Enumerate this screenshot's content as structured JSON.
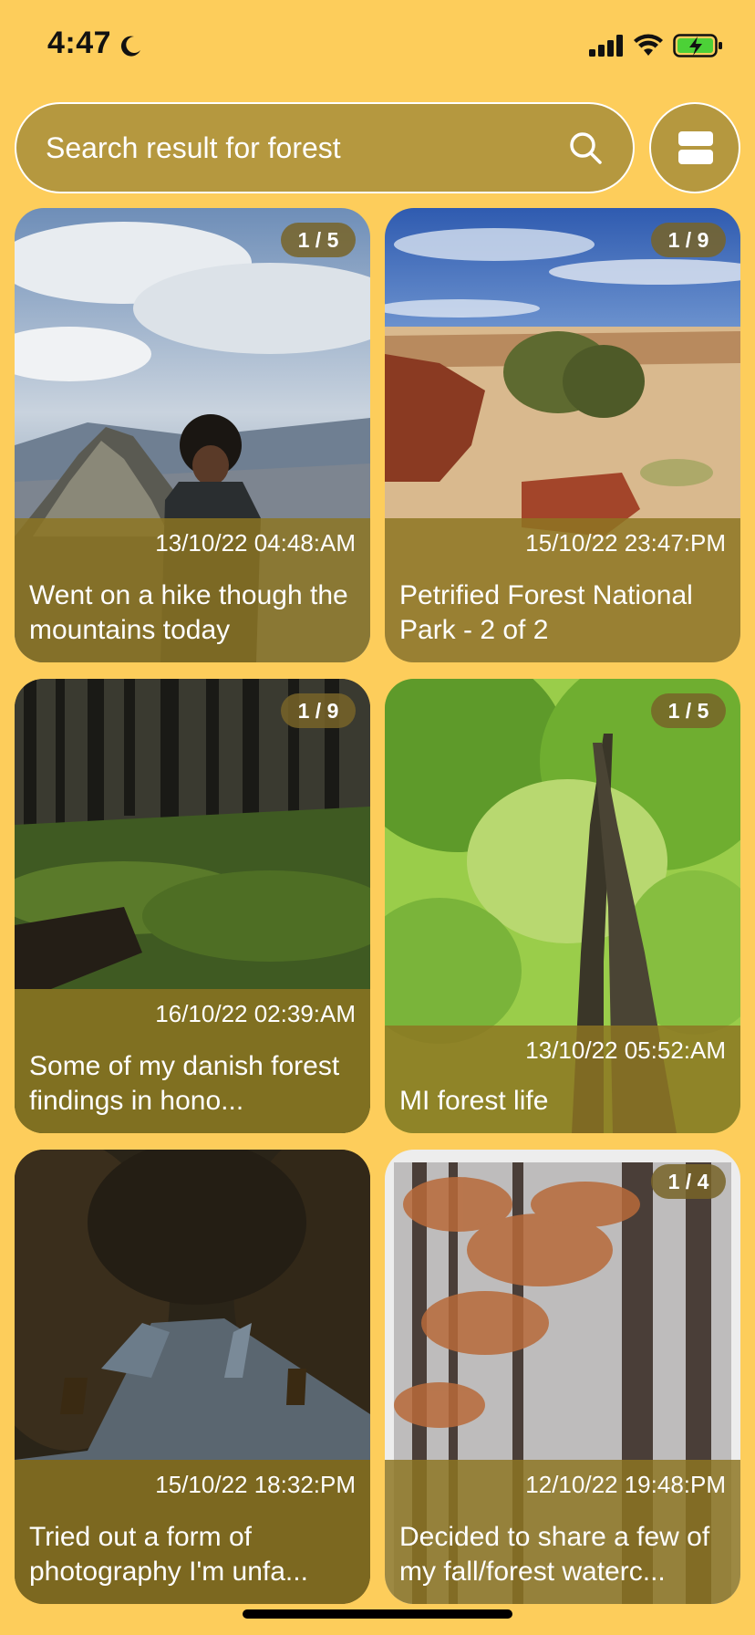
{
  "status": {
    "time": "4:47",
    "icons": [
      "moon-icon",
      "cellular-signal-icon",
      "wifi-icon",
      "battery-charging-icon"
    ]
  },
  "search": {
    "placeholder": "Search result for forest",
    "icon": "search-icon"
  },
  "layout_toggle": {
    "icon": "list-view-icon"
  },
  "colors": {
    "background": "#FDCD5B",
    "search_fill": "#B5983F",
    "overlay": "#8C731E",
    "text": "#FFFFFF"
  },
  "posts": [
    {
      "badge": "1 / 5",
      "date": "13/10/22 04:48:AM",
      "caption": "Went on a hike though the mountains today"
    },
    {
      "badge": "1 / 9",
      "date": "15/10/22 23:47:PM",
      "caption": "Petrified Forest National Park - 2 of 2"
    },
    {
      "badge": "1 / 9",
      "date": "16/10/22 02:39:AM",
      "caption": "Some of my danish forest findings in hono..."
    },
    {
      "badge": "1 / 5",
      "date": "13/10/22 05:52:AM",
      "caption": "MI forest life"
    },
    {
      "badge": "",
      "date": "15/10/22 18:32:PM",
      "caption": "Tried out a form of photography I'm unfa..."
    },
    {
      "badge": "1 / 4",
      "date": "12/10/22 19:48:PM",
      "caption": "Decided to share a few of my fall/forest waterc..."
    }
  ]
}
